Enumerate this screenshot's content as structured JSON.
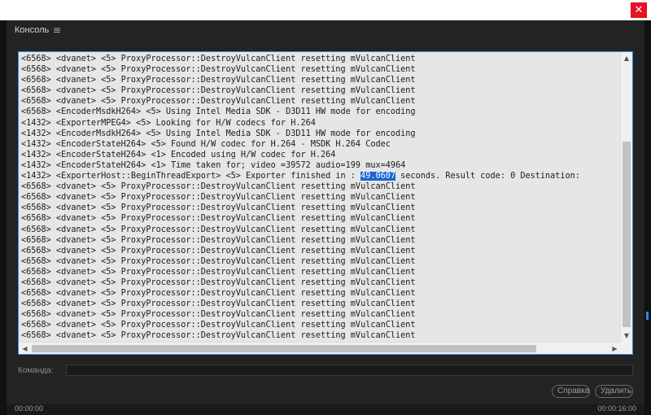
{
  "window": {
    "close_glyph": "✕"
  },
  "panel": {
    "title": "Консоль",
    "menu_icon": "≡"
  },
  "console": {
    "lines_before": [
      "<6568> <dvanet> <5> ProxyProcessor::DestroyVulcanClient resetting mVulcanClient",
      "<6568> <dvanet> <5> ProxyProcessor::DestroyVulcanClient resetting mVulcanClient",
      "<6568> <dvanet> <5> ProxyProcessor::DestroyVulcanClient resetting mVulcanClient",
      "<6568> <dvanet> <5> ProxyProcessor::DestroyVulcanClient resetting mVulcanClient",
      "<6568> <dvanet> <5> ProxyProcessor::DestroyVulcanClient resetting mVulcanClient",
      "<6568> <EncoderMsdkH264> <5> Using Intel Media SDK - D3D11 HW mode for encoding",
      "<1432> <ExporterMPEG4> <5> Looking for H/W codecs for H.264",
      "<1432> <EncoderMsdkH264> <5> Using Intel Media SDK - D3D11 HW mode for encoding",
      "<1432> <EncoderStateH264> <5> Found H/W codec for H.264 - MSDK H.264 Codec",
      "<1432> <EncoderStateH264> <1> Encoded using H/W codec for H.264",
      "<1432> <EncoderStateH264> <1> Time taken for; video =39572 audio=199 mux=4964"
    ],
    "highlight_line": {
      "prefix": "<1432> <ExporterHost::BeginThreadExport> <5> Exporter finished in : ",
      "selected": "49.0607",
      "suffix": " seconds. Result code: 0 Destination: "
    },
    "lines_after": [
      "<6568> <dvanet> <5> ProxyProcessor::DestroyVulcanClient resetting mVulcanClient",
      "<6568> <dvanet> <5> ProxyProcessor::DestroyVulcanClient resetting mVulcanClient",
      "<6568> <dvanet> <5> ProxyProcessor::DestroyVulcanClient resetting mVulcanClient",
      "<6568> <dvanet> <5> ProxyProcessor::DestroyVulcanClient resetting mVulcanClient",
      "<6568> <dvanet> <5> ProxyProcessor::DestroyVulcanClient resetting mVulcanClient",
      "<6568> <dvanet> <5> ProxyProcessor::DestroyVulcanClient resetting mVulcanClient",
      "<6568> <dvanet> <5> ProxyProcessor::DestroyVulcanClient resetting mVulcanClient",
      "<6568> <dvanet> <5> ProxyProcessor::DestroyVulcanClient resetting mVulcanClient",
      "<6568> <dvanet> <5> ProxyProcessor::DestroyVulcanClient resetting mVulcanClient",
      "<6568> <dvanet> <5> ProxyProcessor::DestroyVulcanClient resetting mVulcanClient",
      "<6568> <dvanet> <5> ProxyProcessor::DestroyVulcanClient resetting mVulcanClient",
      "<6568> <dvanet> <5> ProxyProcessor::DestroyVulcanClient resetting mVulcanClient",
      "<6568> <dvanet> <5> ProxyProcessor::DestroyVulcanClient resetting mVulcanClient",
      "<6568> <dvanet> <5> ProxyProcessor::DestroyVulcanClient resetting mVulcanClient",
      "<6568> <dvanet> <5> ProxyProcessor::DestroyVulcanClient resetting mVulcanClient"
    ]
  },
  "command": {
    "label": "Команда:",
    "value": ""
  },
  "buttons": {
    "help": "Справка",
    "delete": "Удалить"
  },
  "bottom": {
    "time_left": "00:00:00",
    "time_right": "00:00:16:00"
  },
  "colors": {
    "accent": "#2d8ceb",
    "close": "#e81123",
    "selection": "#1a64d6"
  },
  "icons": {
    "scroll_up": "▲",
    "scroll_down": "▼",
    "scroll_left": "◀",
    "scroll_right": "▶"
  }
}
